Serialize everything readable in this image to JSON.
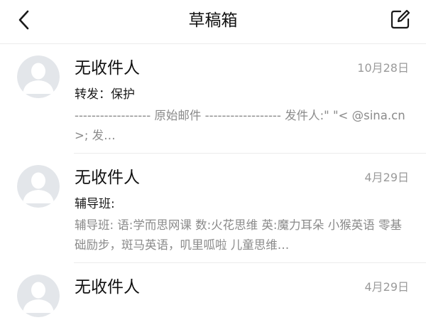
{
  "header": {
    "title": "草稿箱",
    "back_icon": "chevron-left-icon",
    "compose_icon": "edit-square-icon"
  },
  "drafts": [
    {
      "recipient": "无收件人",
      "date": "10月28日",
      "subject": "转发：保护",
      "preview": "------------------ 原始邮件 ------------------ 发件人:\" \"< @sina.cn>; 发…"
    },
    {
      "recipient": "无收件人",
      "date": "4月29日",
      "subject": "辅导班:",
      "preview": "辅导班: 语:学而思网课 数:火花思维 英:魔力耳朵 小猴英语 零基础励步，斑马英语，叽里呱啦 儿童思维…"
    },
    {
      "recipient": "无收件人",
      "date": "4月29日",
      "subject": "",
      "preview": ""
    }
  ],
  "colors": {
    "avatar_bg": "#e3e6ea",
    "avatar_figure": "#ffffff",
    "text_primary": "#111111",
    "text_secondary": "#8a8a8a",
    "date": "#9a9a9a",
    "divider": "#ececec"
  }
}
